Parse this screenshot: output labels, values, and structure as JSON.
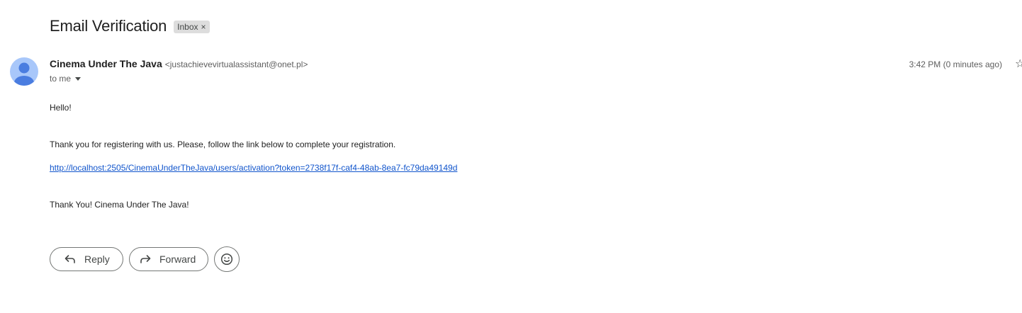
{
  "email": {
    "subject": "Email Verification",
    "label": {
      "text": "Inbox",
      "remove_glyph": "×"
    },
    "sender": {
      "name": "Cinema Under The Java",
      "email": "<justachievevirtualassistant@onet.pl>",
      "avatar_color": "#a8c7fa",
      "avatar_icon": "person-icon"
    },
    "recipient": "to me",
    "timestamp": "3:42 PM (0 minutes ago)",
    "body": {
      "greeting": "Hello!",
      "message": "Thank you for registering with us. Please, follow the link below to complete your registration.",
      "link": "http://localhost:2505/CinemaUnderTheJava/users/activation?token=2738f17f-caf4-48ab-8ea7-fc79da49149d",
      "signoff": "Thank You! Cinema Under The Java!"
    }
  },
  "actions": {
    "reply_label": "Reply",
    "forward_label": "Forward",
    "reply_icon": "reply-icon",
    "forward_icon": "forward-icon",
    "emoji_icon": "emoji-reaction-icon"
  },
  "colors": {
    "link": "#1155cc",
    "chip_bg": "#dddddd",
    "avatar_bg": "#a8c7fa",
    "avatar_figure": "#4a7de0"
  }
}
